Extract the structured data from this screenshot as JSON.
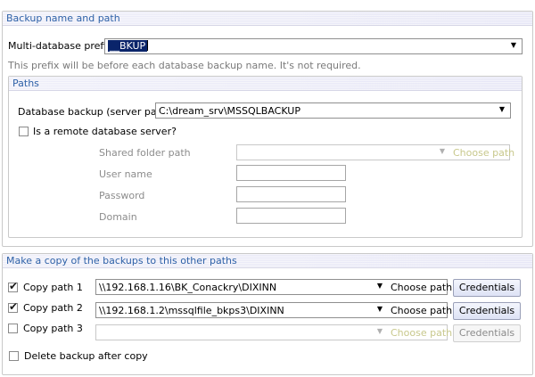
{
  "backup_section": {
    "title": "Backup name and path",
    "prefix_label": "Multi-database prefix",
    "prefix_value": "__BKUP",
    "prefix_hint": "This prefix will be before each database backup name.  It's not required.",
    "paths": {
      "title": "Paths",
      "db_backup_label": "Database backup (server path)",
      "db_backup_value": "C:\\dream_srv\\MSSQLBACKUP",
      "remote_checkbox_label": "Is a remote database server?",
      "remote_checked": false,
      "shared_folder_label": "Shared folder path",
      "shared_folder_value": "",
      "choose_path_label": "Choose path",
      "username_label": "User name",
      "password_label": "Password",
      "domain_label": "Domain"
    }
  },
  "copy_section": {
    "title": "Make a copy of the backups to this other paths",
    "rows": [
      {
        "label": "Copy path 1",
        "checked": true,
        "value": "\\\\192.168.1.16\\BK_Conackry\\DIXINN",
        "choose": "Choose path",
        "credentials": "Credentials",
        "enabled": true
      },
      {
        "label": "Copy path 2",
        "checked": true,
        "value": "\\\\192.168.1.2\\mssqlfile_bkps3\\DIXINN",
        "choose": "Choose path",
        "credentials": "Credentials",
        "enabled": true
      },
      {
        "label": "Copy path 3",
        "checked": false,
        "value": "",
        "choose": "Choose path",
        "credentials": "Credentials",
        "enabled": false
      }
    ],
    "delete_after_label": "Delete backup after copy",
    "delete_after_checked": false
  },
  "icons": {
    "dropdown": "chevron-down-icon",
    "check": "checkmark-icon"
  },
  "colors": {
    "header_text": "#2f62a8",
    "selection": "#0a246a",
    "disabled_text": "#8c8c8c"
  }
}
